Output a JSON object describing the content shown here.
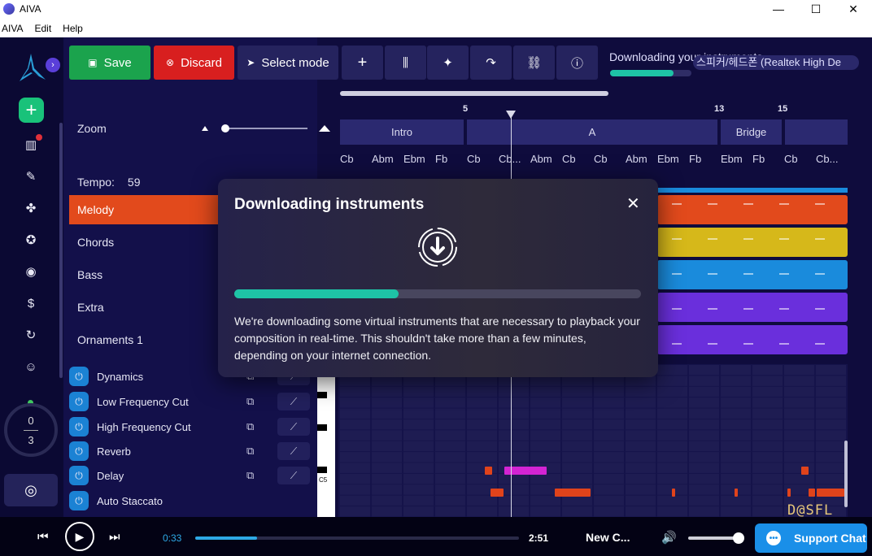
{
  "window": {
    "title": "AIVA",
    "controls": [
      "—",
      "☐",
      "✕"
    ]
  },
  "menu": [
    "AIVA",
    "Edit",
    "Help"
  ],
  "toolbar": {
    "save": "Save",
    "discard": "Discard",
    "select_mode": "Select mode",
    "download_status": "Downloading your instruments",
    "download_progress": 0.78,
    "audio_device": "스피커/헤드폰 (Realtek High De"
  },
  "nav": {
    "usage_used": "0",
    "usage_total": "3"
  },
  "panel": {
    "zoom_label": "Zoom",
    "tempo_label": "Tempo:",
    "tempo_value": "59",
    "tracks": [
      "Melody",
      "Chords",
      "Bass",
      "Extra",
      "Ornaments 1"
    ],
    "effects": [
      "Dynamics",
      "Low Frequency Cut",
      "High Frequency Cut",
      "Reverb",
      "Delay",
      "Auto Staccato"
    ]
  },
  "timeline": {
    "bars": [
      "5",
      "13",
      "15"
    ],
    "sections": [
      "Intro",
      "A",
      "Bridge"
    ],
    "chords": [
      "Cb",
      "Abm",
      "Ebm",
      "Fb",
      "Cb",
      "Cb...",
      "Abm",
      "Cb",
      "Cb",
      "Abm",
      "Ebm",
      "Fb",
      "Ebm",
      "Fb",
      "Cb",
      "Cb..."
    ],
    "key_label": "C5",
    "lane_colors": [
      "#e24a1c",
      "#d6b81a",
      "#1a8bdc",
      "#6a2fdc",
      "#6a2fdc"
    ]
  },
  "modal": {
    "title": "Downloading instruments",
    "close": "✕",
    "progress": 0.404,
    "text": "We're downloading some virtual instruments that are necessary to playback your composition in real-time. This shouldn't take more than a few minutes, depending on your internet connection."
  },
  "transport": {
    "current_time": "0:33",
    "total_time": "2:51",
    "song_title": "New C...",
    "progress": 0.19,
    "support": "Support Chat"
  },
  "watermark": "D@SFL"
}
